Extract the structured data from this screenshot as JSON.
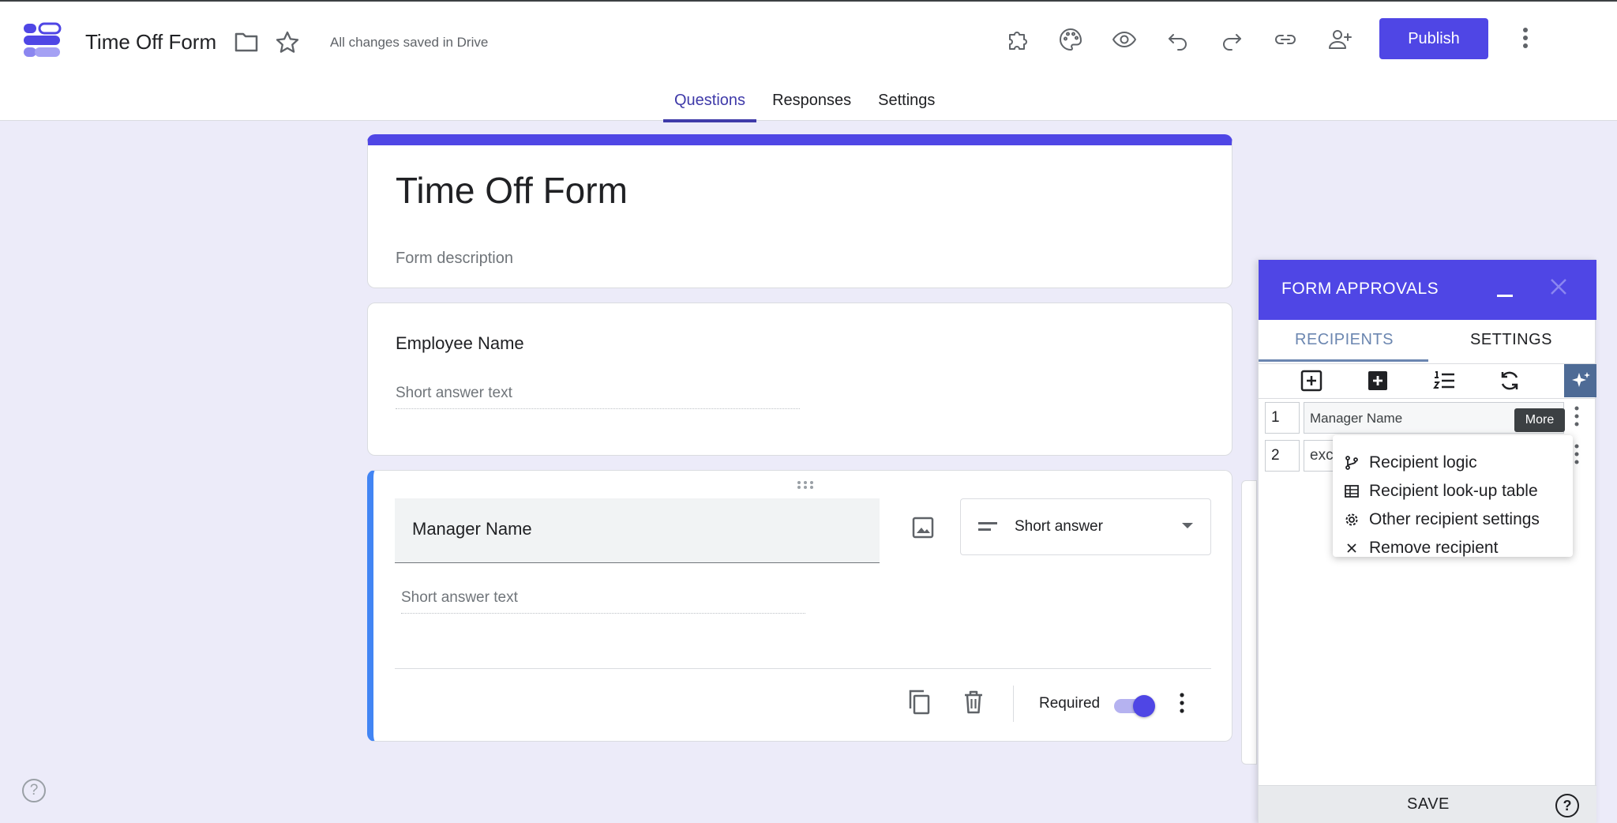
{
  "header": {
    "app_title": "Time Off Form",
    "save_status": "All changes saved in Drive",
    "publish_label": "Publish",
    "tabs": [
      {
        "label": "Questions",
        "active": true
      },
      {
        "label": "Responses",
        "active": false
      },
      {
        "label": "Settings",
        "active": false
      }
    ],
    "accent": "#4f46e5"
  },
  "form": {
    "title": "Time Off Form",
    "description_placeholder": "Form description",
    "questions": [
      {
        "title": "Employee Name",
        "answer_placeholder": "Short answer text"
      },
      {
        "title": "Manager Name",
        "answer_placeholder": "Short answer text",
        "type": "Short answer",
        "required_label": "Required",
        "required": true
      }
    ]
  },
  "approvals_panel": {
    "title": "FORM APPROVALS",
    "tabs": [
      "RECIPIENTS",
      "SETTINGS"
    ],
    "rows": [
      {
        "num": "1",
        "field": "Manager Name"
      },
      {
        "num": "2",
        "field": "exc"
      }
    ],
    "tooltip": "More",
    "save_label": "SAVE",
    "help_glyph": "?"
  },
  "context_menu": {
    "items": [
      {
        "label": "Recipient logic",
        "icon": "branch-icon"
      },
      {
        "label": "Recipient look-up table",
        "icon": "table-icon"
      },
      {
        "label": "Other recipient settings",
        "icon": "gear-icon"
      },
      {
        "label": "Remove recipient",
        "icon": "close-icon"
      }
    ]
  },
  "footer": {
    "help_glyph": "?"
  }
}
